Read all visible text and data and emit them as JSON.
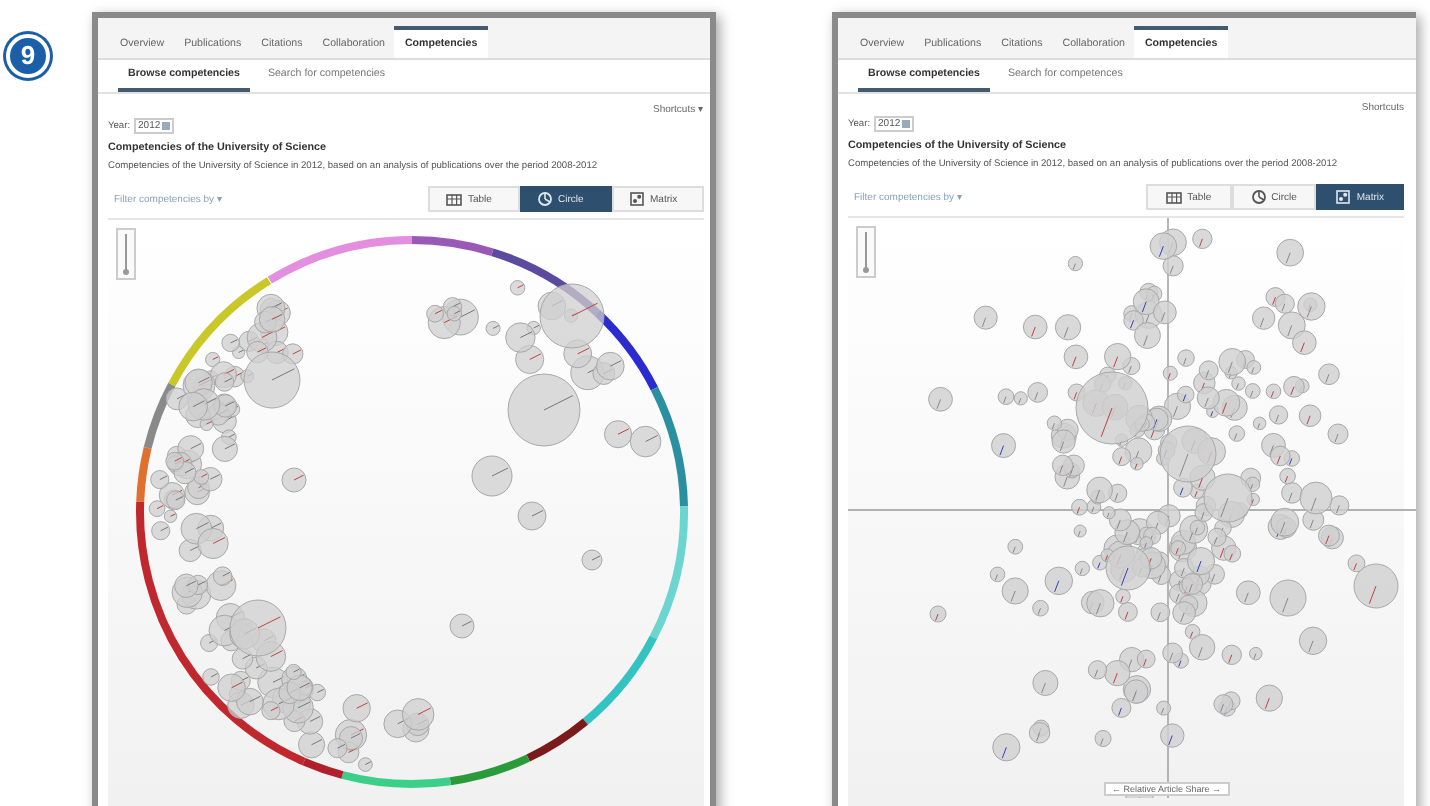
{
  "step_badge": "9",
  "panels": [
    {
      "tabs": [
        {
          "label": "Overview",
          "selected": false
        },
        {
          "label": "Publications",
          "selected": false
        },
        {
          "label": "Citations",
          "selected": false
        },
        {
          "label": "Collaboration",
          "selected": false
        },
        {
          "label": "Competencies",
          "selected": true
        }
      ],
      "subtabs": [
        {
          "label": "Browse competencies",
          "selected": true
        },
        {
          "label": "Search for competencies",
          "selected": false
        }
      ],
      "shortcuts": "Shortcuts ▾",
      "year_label": "Year:",
      "year": "2012",
      "title": "Competencies of the University of Science",
      "description": "Competencies of the University of Science in 2012, based on an analysis of publications over the period 2008-2012",
      "filter": "Filter competencies by ▾",
      "view_buttons": [
        {
          "label": "Table",
          "kind": "table",
          "selected": false
        },
        {
          "label": "Circle",
          "kind": "circle",
          "selected": true
        },
        {
          "label": "Matrix",
          "kind": "matrix",
          "selected": false
        }
      ],
      "kind": "circle"
    },
    {
      "tabs": [
        {
          "label": "Overview",
          "selected": false
        },
        {
          "label": "Publications",
          "selected": false
        },
        {
          "label": "Citations",
          "selected": false
        },
        {
          "label": "Collaboration",
          "selected": false
        },
        {
          "label": "Competencies",
          "selected": true
        }
      ],
      "subtabs": [
        {
          "label": "Browse competencies",
          "selected": true
        },
        {
          "label": "Search for competences",
          "selected": false
        }
      ],
      "shortcuts": "Shortcuts",
      "year_label": "Year:",
      "year": "2012",
      "title": "Competencies of the University of Science",
      "description": "Competencies of the University of Science in 2012, based on an analysis of publications over the period 2008-2012",
      "filter": "Filter competencies by ▾",
      "view_buttons": [
        {
          "label": "Table",
          "kind": "table",
          "selected": false
        },
        {
          "label": "Circle",
          "kind": "circle",
          "selected": false
        },
        {
          "label": "Matrix",
          "kind": "matrix",
          "selected": true
        }
      ],
      "kind": "matrix",
      "x_axis_label": "← Relative Article Share →"
    }
  ]
}
